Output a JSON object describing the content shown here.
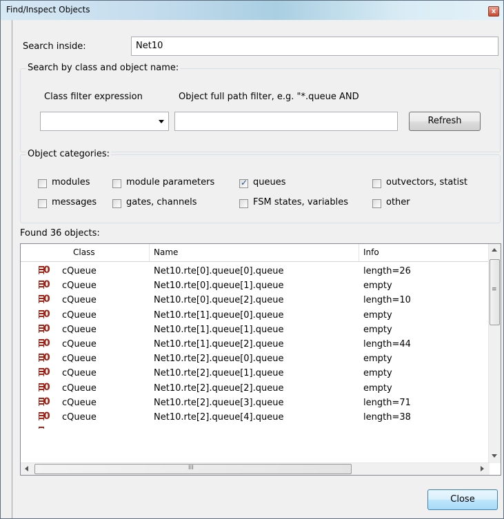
{
  "window": {
    "title": "Find/Inspect Objects",
    "close_glyph": "x"
  },
  "search": {
    "label": "Search inside:",
    "value": "Net10"
  },
  "search_by": {
    "legend": "Search by class and object name:",
    "class_filter_label": "Class filter expression",
    "class_filter_value": "",
    "path_filter_label": "Object full path filter, e.g. \"*.queue AND",
    "path_filter_value": "",
    "refresh_label": "Refresh"
  },
  "categories": {
    "legend": "Object categories:",
    "items": [
      {
        "label": "modules",
        "checked": false
      },
      {
        "label": "module parameters",
        "checked": false
      },
      {
        "label": "queues",
        "checked": true
      },
      {
        "label": "outvectors, statist",
        "checked": false
      },
      {
        "label": "messages",
        "checked": false
      },
      {
        "label": "gates, channels",
        "checked": false
      },
      {
        "label": "FSM states, variables",
        "checked": false
      },
      {
        "label": "other",
        "checked": false
      }
    ]
  },
  "results": {
    "found_label": "Found 36 objects:",
    "columns": [
      "Class",
      "Name",
      "Info"
    ],
    "rows": [
      {
        "class": "cQueue",
        "name": "Net10.rte[0].queue[0].queue",
        "info": "length=26"
      },
      {
        "class": "cQueue",
        "name": "Net10.rte[0].queue[1].queue",
        "info": "empty"
      },
      {
        "class": "cQueue",
        "name": "Net10.rte[0].queue[2].queue",
        "info": "length=10"
      },
      {
        "class": "cQueue",
        "name": "Net10.rte[1].queue[0].queue",
        "info": "empty"
      },
      {
        "class": "cQueue",
        "name": "Net10.rte[1].queue[1].queue",
        "info": "empty"
      },
      {
        "class": "cQueue",
        "name": "Net10.rte[1].queue[2].queue",
        "info": "length=44"
      },
      {
        "class": "cQueue",
        "name": "Net10.rte[2].queue[0].queue",
        "info": "empty"
      },
      {
        "class": "cQueue",
        "name": "Net10.rte[2].queue[1].queue",
        "info": "empty"
      },
      {
        "class": "cQueue",
        "name": "Net10.rte[2].queue[2].queue",
        "info": "empty"
      },
      {
        "class": "cQueue",
        "name": "Net10.rte[2].queue[3].queue",
        "info": "length=71"
      },
      {
        "class": "cQueue",
        "name": "Net10.rte[2].queue[4].queue",
        "info": "length=38"
      }
    ],
    "row_icon": "queue-icon",
    "hscroll_grip": "III",
    "vscroll_grip": "≡"
  },
  "footer": {
    "close_label": "Close"
  }
}
